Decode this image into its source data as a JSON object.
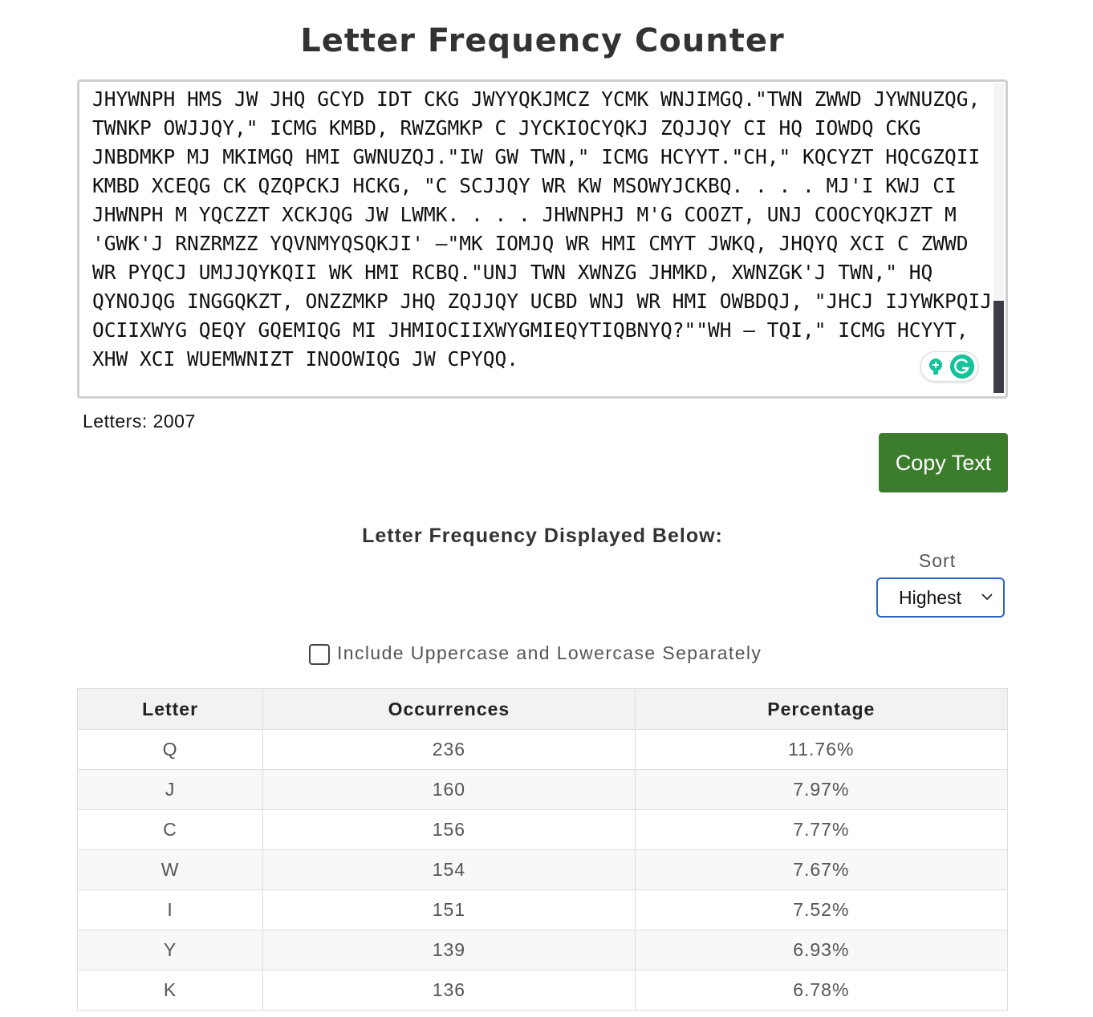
{
  "title": "Letter Frequency Counter",
  "input_text_lines": [
    "JHYWNPH HMS JW JHQ GCYD IDT CKG JWYYQKJMCZ YCMK WNJIMGQ.\"TWN ZWWD JYWNUZQG,",
    "TWNKP OWJJQY,\" ICMG KMBD, RWZGMKP C JYCKIOCYQKJ ZQJJQY CI HQ IOWDQ CKG",
    "JNBDMKP MJ MKIMGQ HMI GWNUZQJ.\"IW GW TWN,\" ICMG HCYYT.\"CH,\" KQCYZT HQCGZQII",
    "KMBD XCEQG CK QZQPCKJ HCKG, \"C SCJJQY WR KW MSOWYJCKBQ. . . . MJ'I KWJ CI",
    "JHWNPH M YQCZZT XCKJQG JW LWMK. . . . JHWNPHJ M'G COOZT, UNJ COOCYQKJZT M",
    "'GWK'J RNZRMZZ YQVNMYQSQKJI' —\"MK IOMJQ WR HMI CMYT JWKQ, JHQYQ XCI C ZWWD",
    "WR PYQCJ UMJJQYKQII WK HMI RCBQ.\"UNJ TWN XWNZG JHMKD, XWNZGK'J TWN,\" HQ",
    "QYNOJQG INGGQKZT, ONZZMKP JHQ ZQJJQY UCBD WNJ WR HMI OWBDQJ, \"JHCJ IJYWKPQIJ",
    "OCIIXWYG QEQY GQEMIQG MI JHMIOCIIXWYGMIEQYTIQBNYQ?\"\"WH — TQI,\" ICMG HCYYT,",
    "XHW XCI WUEMWNIZT INOOWIQG JW CPYQQ."
  ],
  "letters_count_label": "Letters: 2007",
  "copy_button_label": "Copy Text",
  "section_heading": "Letter Frequency Displayed Below:",
  "sort": {
    "label": "Sort",
    "selected": "Highest"
  },
  "case_option": {
    "label": "Include Uppercase and Lowercase Separately",
    "checked": false
  },
  "table": {
    "headers": [
      "Letter",
      "Occurrences",
      "Percentage"
    ],
    "rows": [
      {
        "letter": "Q",
        "occurrences": "236",
        "percentage": "11.76%"
      },
      {
        "letter": "J",
        "occurrences": "160",
        "percentage": "7.97%"
      },
      {
        "letter": "C",
        "occurrences": "156",
        "percentage": "7.77%"
      },
      {
        "letter": "W",
        "occurrences": "154",
        "percentage": "7.67%"
      },
      {
        "letter": "I",
        "occurrences": "151",
        "percentage": "7.52%"
      },
      {
        "letter": "Y",
        "occurrences": "139",
        "percentage": "6.93%"
      },
      {
        "letter": "K",
        "occurrences": "136",
        "percentage": "6.78%"
      }
    ]
  },
  "icons": {
    "grammarly_suggestion": "lightbulb-icon",
    "grammarly_logo": "grammarly-icon",
    "sort_dropdown": "chevron-down-icon"
  },
  "colors": {
    "copy_button": "#3b7d2c",
    "select_border": "#2f66c4",
    "scrollbar_thumb": "#3d3d4a",
    "grammarly_green": "#15c39a"
  }
}
